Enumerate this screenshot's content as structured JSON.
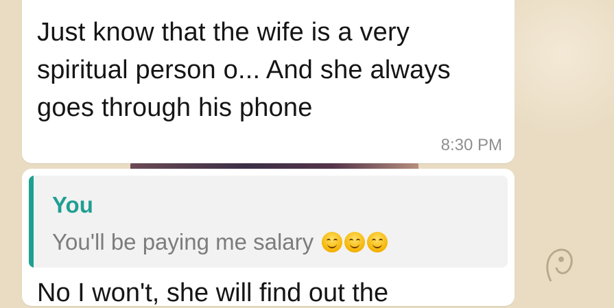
{
  "chat": {
    "message_1": {
      "text": "Just know that the wife is a very spiritual person o... And she always goes through his phone",
      "time": "8:30 PM"
    },
    "message_2": {
      "quote_sender": "You",
      "quote_text": "You'll be paying me salary",
      "quote_emojis": [
        "smiling-face-icon",
        "smiling-face-icon",
        "smiling-face-icon"
      ],
      "text_partial": "No I won't, she will find out the"
    }
  },
  "colors": {
    "quote_accent": "#1f9f91",
    "bubble": "#ffffff",
    "wallpaper": "#e7d9bf"
  }
}
